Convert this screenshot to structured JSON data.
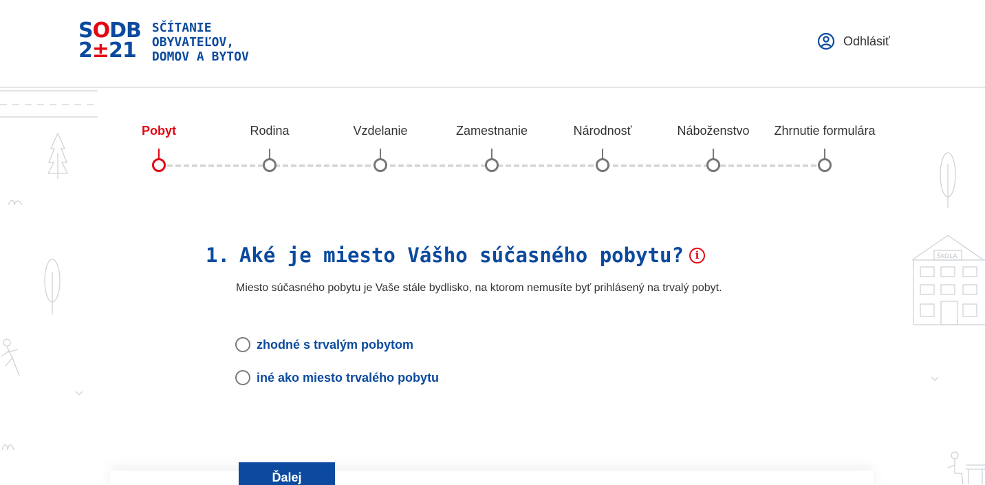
{
  "logo": {
    "line1_a": "S",
    "line1_o": "O",
    "line1_b": "DB",
    "line2_a": "2",
    "line2_pm": "±",
    "line2_b": "21",
    "text_line1": "SČÍTANIE",
    "text_line2": "OBYVATEĽOV,",
    "text_line3": "DOMOV A BYTOV"
  },
  "header": {
    "logout_label": "Odhlásiť",
    "logout_icon": "user-circle-icon"
  },
  "steps": [
    {
      "label": "Pobyt",
      "active": true
    },
    {
      "label": "Rodina",
      "active": false
    },
    {
      "label": "Vzdelanie",
      "active": false
    },
    {
      "label": "Zamestnanie",
      "active": false
    },
    {
      "label": "Národnosť",
      "active": false
    },
    {
      "label": "Náboženstvo",
      "active": false
    },
    {
      "label": "Zhrnutie formulára",
      "active": false
    }
  ],
  "question": {
    "number": "1.",
    "text": "Aké je miesto Vášho súčasného pobytu?",
    "info_icon": "info-icon",
    "help_text": "Miesto súčasného pobytu je Vaše stále bydlisko, na ktorom nemusíte byť prihlásený na trvalý pobyt."
  },
  "options": [
    {
      "label": "zhodné s trvalým pobytom",
      "selected": false
    },
    {
      "label": "iné ako miesto trvalého pobytu",
      "selected": false
    }
  ],
  "actions": {
    "next_label": "Ďalej"
  },
  "decor": {
    "school_sign": "ŠKOLA"
  },
  "colors": {
    "brand_blue": "#0b4a9e",
    "accent_red": "#e30613",
    "step_gray": "#777777"
  }
}
